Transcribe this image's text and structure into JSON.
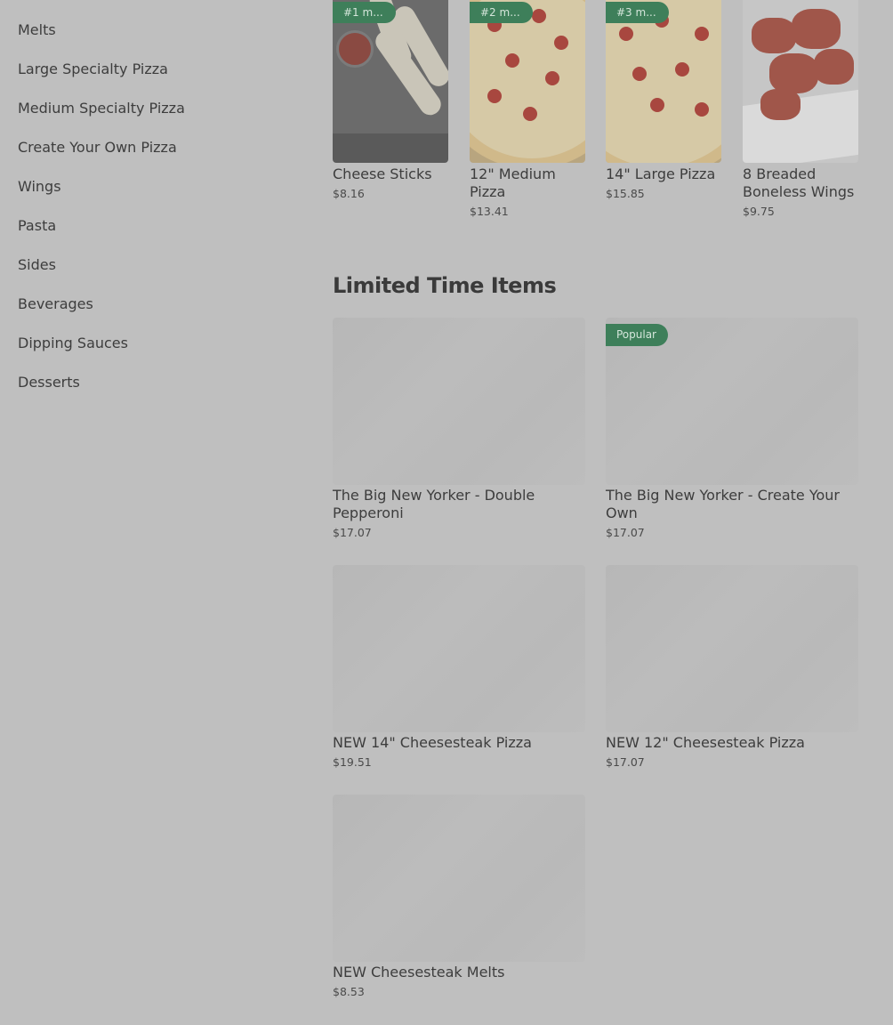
{
  "sidebar": {
    "items": [
      {
        "label": "Melts"
      },
      {
        "label": "Large Specialty Pizza"
      },
      {
        "label": "Medium Specialty Pizza"
      },
      {
        "label": "Create Your Own Pizza"
      },
      {
        "label": "Wings"
      },
      {
        "label": "Pasta"
      },
      {
        "label": "Sides"
      },
      {
        "label": "Beverages"
      },
      {
        "label": "Dipping Sauces"
      },
      {
        "label": "Desserts"
      }
    ]
  },
  "popular": {
    "items": [
      {
        "badge": "#1 m...",
        "title": "Cheese Sticks",
        "price": "$8.16"
      },
      {
        "badge": "#2 m...",
        "title": "12\" Medium Pizza",
        "price": "$13.41"
      },
      {
        "badge": "#3 m...",
        "title": "14\" Large Pizza",
        "price": "$15.85"
      },
      {
        "badge": "",
        "title": "8 Breaded Boneless Wings",
        "price": "$9.75"
      }
    ]
  },
  "limited": {
    "title": "Limited Time Items",
    "items": [
      {
        "badge": "",
        "title": "The Big New Yorker - Double Pepperoni",
        "price": "$17.07"
      },
      {
        "badge": "Popular",
        "title": "The Big New Yorker - Create Your Own",
        "price": "$17.07"
      },
      {
        "badge": "",
        "title": "NEW 14\" Cheesesteak Pizza",
        "price": "$19.51"
      },
      {
        "badge": "",
        "title": "NEW 12\" Cheesesteak Pizza",
        "price": "$17.07"
      },
      {
        "badge": "",
        "title": "NEW Cheesesteak Melts",
        "price": "$8.53"
      }
    ]
  },
  "colors": {
    "overlay_bg": "#bfbfbf",
    "badge_bg": "#3e7f5a",
    "text": "#3d3d3d"
  }
}
